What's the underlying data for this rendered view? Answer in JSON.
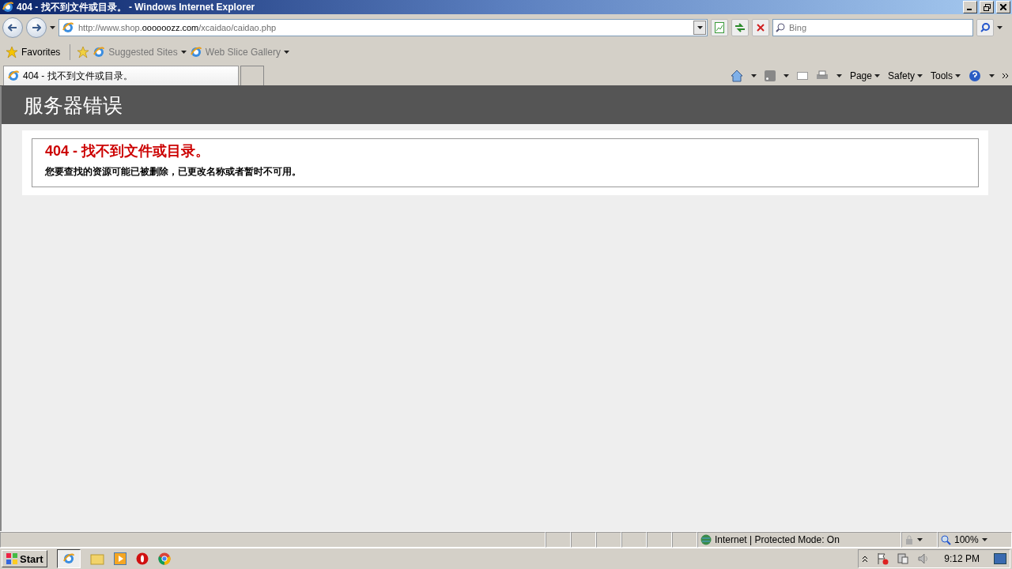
{
  "window": {
    "title": "404 - 找不到文件或目录。 - Windows Internet Explorer"
  },
  "address": {
    "prefix": "http://www.shop.",
    "domain": "oooooozz.com",
    "path": "/xcaidao/caidao.php"
  },
  "search": {
    "placeholder": "Bing"
  },
  "favorites": {
    "label": "Favorites",
    "links": [
      {
        "label": "Suggested Sites"
      },
      {
        "label": "Web Slice Gallery"
      }
    ]
  },
  "tabs": [
    {
      "label": "404 - 找不到文件或目录。",
      "selected": true
    }
  ],
  "commands": [
    {
      "label": "Page"
    },
    {
      "label": "Safety"
    },
    {
      "label": "Tools"
    }
  ],
  "page": {
    "header": "服务器错误",
    "error_title": "404 - 找不到文件或目录。",
    "error_message": "您要查找的资源可能已被删除，已更改名称或者暂时不可用。"
  },
  "status_bar": {
    "zone": "Internet | Protected Mode: On",
    "zoom": "100%"
  },
  "taskbar": {
    "start": "Start",
    "clock": "9:12 PM"
  }
}
